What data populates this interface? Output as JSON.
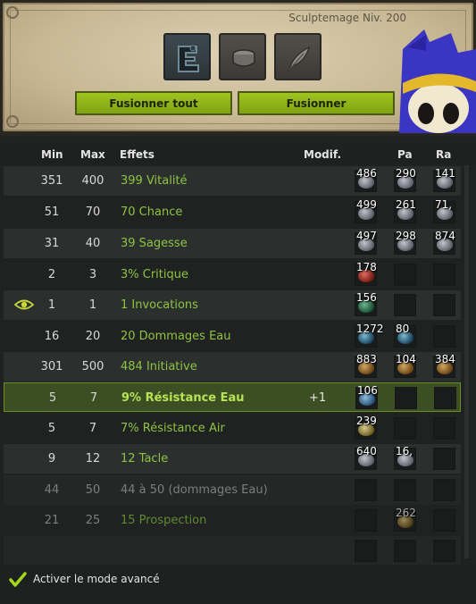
{
  "header": {
    "level_text": "Sculptemage Niv. 200",
    "fuse_all_label": "Fusionner tout",
    "fuse_label": "Fusionner",
    "slots": [
      "item-slot-icon",
      "rune-slot-icon",
      "feather-slot-icon"
    ]
  },
  "columns": {
    "min": "Min",
    "max": "Max",
    "effects": "Effets",
    "modif": "Modif.",
    "pa": "Pa",
    "ra": "Ra"
  },
  "rows": [
    {
      "min": "351",
      "max": "400",
      "effect": "399 Vitalité",
      "modif": "",
      "runes": [
        "486",
        "290",
        "141"
      ]
    },
    {
      "min": "51",
      "max": "70",
      "effect": "70 Chance",
      "modif": "",
      "runes": [
        "499",
        "261",
        "71,"
      ]
    },
    {
      "min": "31",
      "max": "40",
      "effect": "39 Sagesse",
      "modif": "",
      "runes": [
        "497",
        "298",
        "874"
      ]
    },
    {
      "min": "2",
      "max": "3",
      "effect": "3% Critique",
      "modif": "",
      "runes": [
        "178",
        "",
        ""
      ]
    },
    {
      "min": "1",
      "max": "1",
      "effect": "1 Invocations",
      "modif": "",
      "runes": [
        "156",
        "",
        ""
      ]
    },
    {
      "min": "16",
      "max": "20",
      "effect": "20 Dommages Eau",
      "modif": "",
      "runes": [
        "1272",
        "80",
        ""
      ]
    },
    {
      "min": "301",
      "max": "500",
      "effect": "484 Initiative",
      "modif": "",
      "runes": [
        "883",
        "104",
        "384"
      ]
    },
    {
      "min": "5",
      "max": "7",
      "effect": "9% Résistance Eau",
      "modif": "+1",
      "runes": [
        "106",
        "",
        ""
      ]
    },
    {
      "min": "5",
      "max": "7",
      "effect": "7% Résistance Air",
      "modif": "",
      "runes": [
        "239",
        "",
        ""
      ]
    },
    {
      "min": "9",
      "max": "12",
      "effect": "12 Tacle",
      "modif": "",
      "runes": [
        "640",
        "16,",
        ""
      ]
    },
    {
      "min": "44",
      "max": "50",
      "effect": "44 à 50 (dommages Eau)",
      "modif": "",
      "runes": [
        "",
        "",
        ""
      ]
    },
    {
      "min": "21",
      "max": "25",
      "effect": "15 Prospection",
      "modif": "",
      "runes": [
        "",
        "262",
        ""
      ]
    },
    {
      "min": "",
      "max": "",
      "effect": "",
      "modif": "",
      "runes": [
        "",
        "",
        ""
      ]
    }
  ],
  "footer": {
    "advanced_mode_label": "Activer le mode avancé",
    "advanced_mode_checked": true
  },
  "colors": {
    "accent_green": "#8ec340",
    "button_green": "#8fb31a",
    "selected_row": "#3b4f23"
  }
}
